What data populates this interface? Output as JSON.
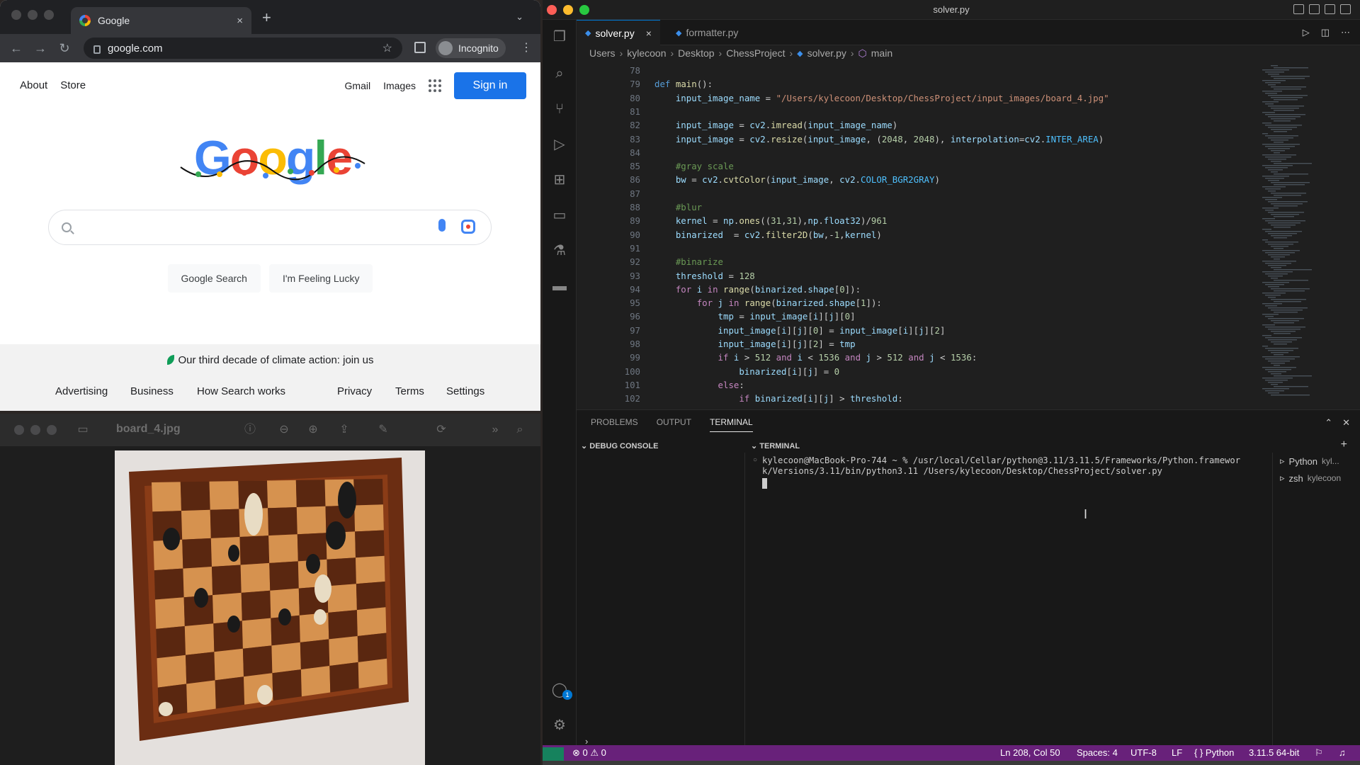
{
  "browser": {
    "tab_title": "Google",
    "tab_close": "×",
    "new_tab": "+",
    "tab_menu": "⌄",
    "url": "google.com",
    "incognito_label": "Incognito",
    "top_links": [
      "About",
      "Store"
    ],
    "top_right": {
      "gmail": "Gmail",
      "images": "Images",
      "sign_in": "Sign in"
    },
    "search_buttons": [
      "Google Search",
      "I'm Feeling Lucky"
    ],
    "climate_text": "Our third decade of climate action: join us",
    "footer_links": [
      "Advertising",
      "Business",
      "How Search works",
      "Privacy",
      "Terms",
      "Settings"
    ],
    "accent_color": "#1a73e8"
  },
  "preview": {
    "file_name": "board_4.jpg"
  },
  "vscode": {
    "window_title": "solver.py",
    "tabs": [
      {
        "label": "solver.py",
        "active": true,
        "close": "×"
      },
      {
        "label": "formatter.py",
        "active": false
      }
    ],
    "breadcrumb": [
      "Users",
      "kylecoon",
      "Desktop",
      "ChessProject",
      "solver.py",
      "main"
    ],
    "code_lines": [
      {
        "n": "78",
        "t": ""
      },
      {
        "n": "79",
        "t": "def main():"
      },
      {
        "n": "80",
        "t": "    input_image_name = \"/Users/kylecoon/Desktop/ChessProject/input_images/board_4.jpg\""
      },
      {
        "n": "81",
        "t": ""
      },
      {
        "n": "82",
        "t": "    input_image = cv2.imread(input_image_name)"
      },
      {
        "n": "83",
        "t": "    input_image = cv2.resize(input_image, (2048, 2048), interpolation=cv2.INTER_AREA)"
      },
      {
        "n": "84",
        "t": ""
      },
      {
        "n": "85",
        "t": "    #gray scale"
      },
      {
        "n": "86",
        "t": "    bw = cv2.cvtColor(input_image, cv2.COLOR_BGR2GRAY)"
      },
      {
        "n": "87",
        "t": ""
      },
      {
        "n": "88",
        "t": "    #blur"
      },
      {
        "n": "89",
        "t": "    kernel = np.ones((31,31),np.float32)/961"
      },
      {
        "n": "90",
        "t": "    binarized  = cv2.filter2D(bw,-1,kernel)"
      },
      {
        "n": "91",
        "t": ""
      },
      {
        "n": "92",
        "t": "    #binarize"
      },
      {
        "n": "93",
        "t": "    threshold = 128"
      },
      {
        "n": "94",
        "t": "    for i in range(binarized.shape[0]):"
      },
      {
        "n": "95",
        "t": "        for j in range(binarized.shape[1]):"
      },
      {
        "n": "96",
        "t": "            tmp = input_image[i][j][0]"
      },
      {
        "n": "97",
        "t": "            input_image[i][j][0] = input_image[i][j][2]"
      },
      {
        "n": "98",
        "t": "            input_image[i][j][2] = tmp"
      },
      {
        "n": "99",
        "t": "            if i > 512 and i < 1536 and j > 512 and j < 1536:"
      },
      {
        "n": "100",
        "t": "                binarized[i][j] = 0"
      },
      {
        "n": "101",
        "t": "            else:"
      },
      {
        "n": "102",
        "t": "                if binarized[i][j] > threshold:"
      }
    ],
    "panel_tabs": [
      "PROBLEMS",
      "OUTPUT",
      "TERMINAL"
    ],
    "debug_console_label": "DEBUG CONSOLE",
    "terminal_label": "TERMINAL",
    "terminal_output": "kylecoon@MacBook-Pro-744 ~ % /usr/local/Cellar/python@3.11/3.11.5/Frameworks/Python.framewor\nk/Versions/3.11/bin/python3.11 /Users/kylecoon/Desktop/ChessProject/solver.py",
    "terminals": [
      {
        "name": "Python",
        "detail": "kyl..."
      },
      {
        "name": "zsh",
        "detail": "kylecoon"
      }
    ],
    "status": {
      "errors": "0",
      "warnings": "0",
      "position": "Ln 208, Col 50",
      "spaces": "Spaces: 4",
      "encoding": "UTF-8",
      "eol": "LF",
      "language": "Python",
      "interpreter": "3.11.5 64-bit"
    },
    "accounts_badge": "1",
    "statusbar_color": "#68217a"
  }
}
